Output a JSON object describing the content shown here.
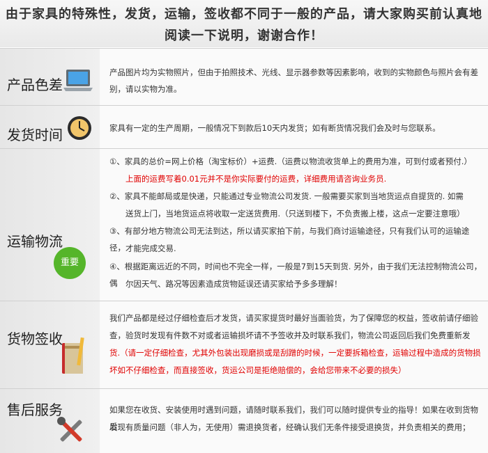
{
  "header": {
    "line1": "由于家具的特殊性，发货，运输，签收都不同于一般的产品，请大家购买前认真地",
    "line2": "阅读一下说明，谢谢合作！"
  },
  "sections": {
    "color": {
      "label": "产品色差",
      "icon": "laptop-icon",
      "text": [
        "产品图片均为实物照片，但由于拍照技术、光线、显示器参数等因素影响，收到的实物颜色与照片会有差",
        "别，请以实物为准。"
      ]
    },
    "delivery": {
      "label": "发货时间",
      "icon": "clock-icon",
      "text": [
        "家具有一定的生产周期，一般情况下到款后10天内发货；如有断货情况我们会及时与您联系。"
      ]
    },
    "shipping": {
      "label": "运输物流",
      "badge": "重要",
      "items": [
        "①、家具的总价=网上价格（淘宝标价）+运费.（运费以物流收货单上的费用为准，可到付或者预付.）",
        "上面的运费写着0.01元并不是你实际要付的运费，详细费用请咨询业务员.",
        "②、家具不能邮局或是快递，只能通过专业物流公司发货. 一般需要买家到当地货运点自提货的. 如需",
        "送货上门，当地货运点将收取一定送货费用.（只送到楼下，不负责搬上楼，这点一定要注意哦）",
        "③、有部分地方物流公司无法到达，所以请买家拍下前，与我们商讨运输途径，只有我们认可的运输途径，",
        "才能完成交易.",
        "④、根据距离远近的不同，时间也不完全一样，一般是7到15天到货. 另外，由于我们无法控制物流公司，偶",
        "尔因天气、路况等因素造成货物延误还请买家给予多多理解！"
      ]
    },
    "receipt": {
      "label": "货物签收",
      "icon": "notebook-pen-icon",
      "lines": [
        "我们产品都是经过仔细检查后才发货，请买家提货时最好当面验货，为了保障您的权益，签收前请仔细验",
        "查，验货时发现有件数不对或者运输损坏请不予签收并及时联系我们，物流公司返回后我们免费重新发",
        "货.（请一定仔细检查，尤其外包装出现磨损或是刮蹭的时候，一定要拆箱检查，运输过程中造成的货物损",
        "坏如不仔细检查，而直接签收，货运公司是拒绝赔偿的，会给您带来不必要的损失）"
      ]
    },
    "service": {
      "label": "售后服务",
      "icon": "tools-icon",
      "text": [
        "如果您在收货、安装使用时遇到问题，请随时联系我们，我们可以随时提供专业的指导！如果在收到货物后",
        "发现有质量问题（非人为，无使用）需退换货者，经确认我们无条件接受退换货，并负责相关的费用；"
      ]
    }
  }
}
